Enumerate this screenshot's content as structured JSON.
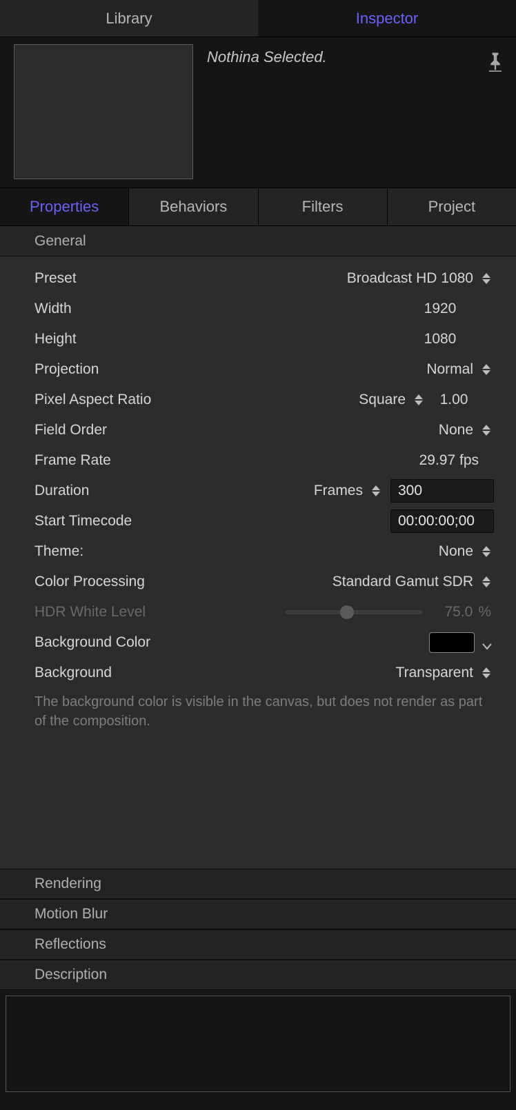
{
  "topTabs": {
    "library": "Library",
    "inspector": "Inspector"
  },
  "preview": {
    "status": "Nothina Selected."
  },
  "subTabs": {
    "properties": "Properties",
    "behaviors": "Behaviors",
    "filters": "Filters",
    "project": "Project"
  },
  "sections": {
    "general": "General",
    "rendering": "Rendering",
    "motionBlur": "Motion Blur",
    "reflections": "Reflections",
    "description": "Description"
  },
  "general": {
    "preset": {
      "label": "Preset",
      "value": "Broadcast HD 1080"
    },
    "width": {
      "label": "Width",
      "value": "1920"
    },
    "height": {
      "label": "Height",
      "value": "1080"
    },
    "projection": {
      "label": "Projection",
      "value": "Normal"
    },
    "pixelAspect": {
      "label": "Pixel Aspect Ratio",
      "value": "Square",
      "num": "1.00"
    },
    "fieldOrder": {
      "label": "Field Order",
      "value": "None"
    },
    "frameRate": {
      "label": "Frame Rate",
      "value": "29.97 fps"
    },
    "duration": {
      "label": "Duration",
      "unit": "Frames",
      "value": "300"
    },
    "startTimecode": {
      "label": "Start Timecode",
      "value": "00:00:00;00"
    },
    "theme": {
      "label": "Theme:",
      "value": "None"
    },
    "colorProcessing": {
      "label": "Color Processing",
      "value": "Standard Gamut SDR"
    },
    "hdrWhite": {
      "label": "HDR White Level",
      "value": "75.0",
      "unit": "%"
    },
    "bgColor": {
      "label": "Background Color",
      "swatch": "#000000"
    },
    "background": {
      "label": "Background",
      "value": "Transparent"
    },
    "hint": "The background color is visible in the canvas, but does not render as part of the composition."
  }
}
